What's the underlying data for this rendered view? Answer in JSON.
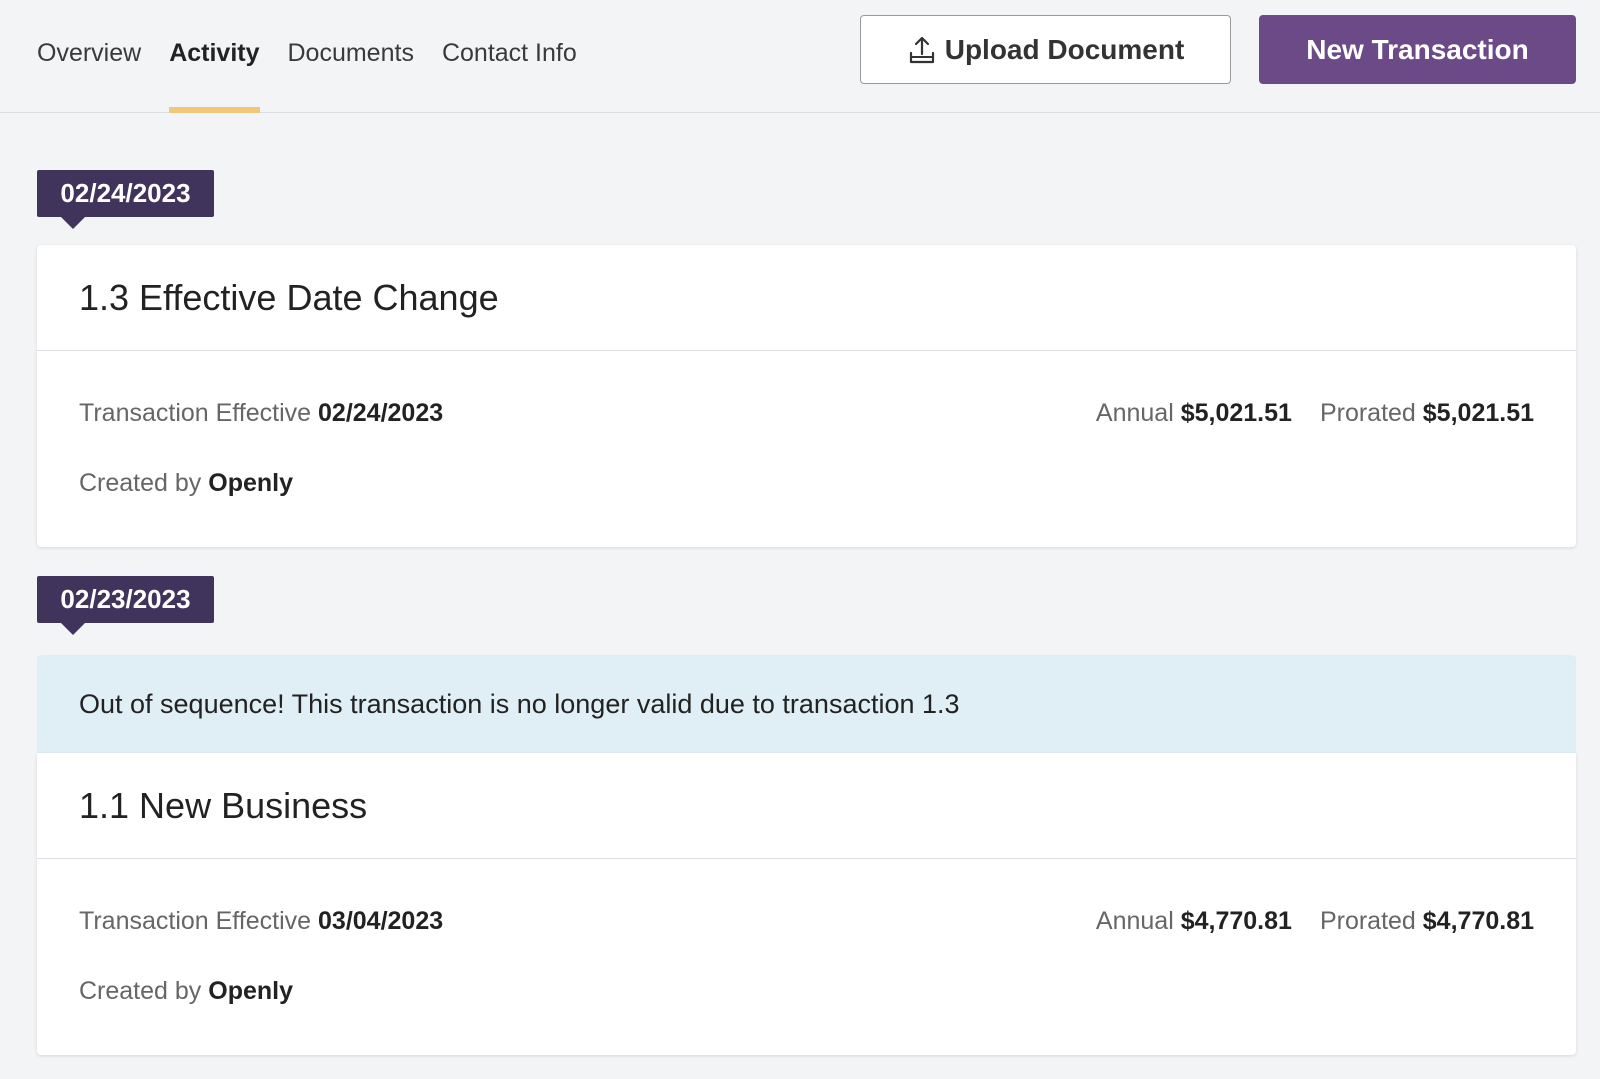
{
  "tabs": [
    {
      "label": "Overview",
      "active": false
    },
    {
      "label": "Activity",
      "active": true
    },
    {
      "label": "Documents",
      "active": false
    },
    {
      "label": "Contact Info",
      "active": false
    }
  ],
  "actions": {
    "upload_label": "Upload Document",
    "upload_icon": "upload-icon",
    "new_transaction_label": "New Transaction"
  },
  "colors": {
    "primary": "#6b4a87",
    "date_tag": "#41345c",
    "active_tab_underline": "#f3c77a",
    "notice_bg": "#e0eff6"
  },
  "timeline": [
    {
      "date": "02/24/2023",
      "title": "1.3 Effective Date Change",
      "effective_label": "Transaction Effective",
      "effective_value": "02/24/2023",
      "created_label": "Created by",
      "created_value": "Openly",
      "annual_label": "Annual",
      "annual_value": "$5,021.51",
      "prorated_label": "Prorated",
      "prorated_value": "$5,021.51"
    },
    {
      "date": "02/23/2023",
      "notice": "Out of sequence! This transaction is no longer valid due to transaction 1.3",
      "title": "1.1 New Business",
      "effective_label": "Transaction Effective",
      "effective_value": "03/04/2023",
      "created_label": "Created by",
      "created_value": "Openly",
      "annual_label": "Annual",
      "annual_value": "$4,770.81",
      "prorated_label": "Prorated",
      "prorated_value": "$4,770.81"
    }
  ]
}
